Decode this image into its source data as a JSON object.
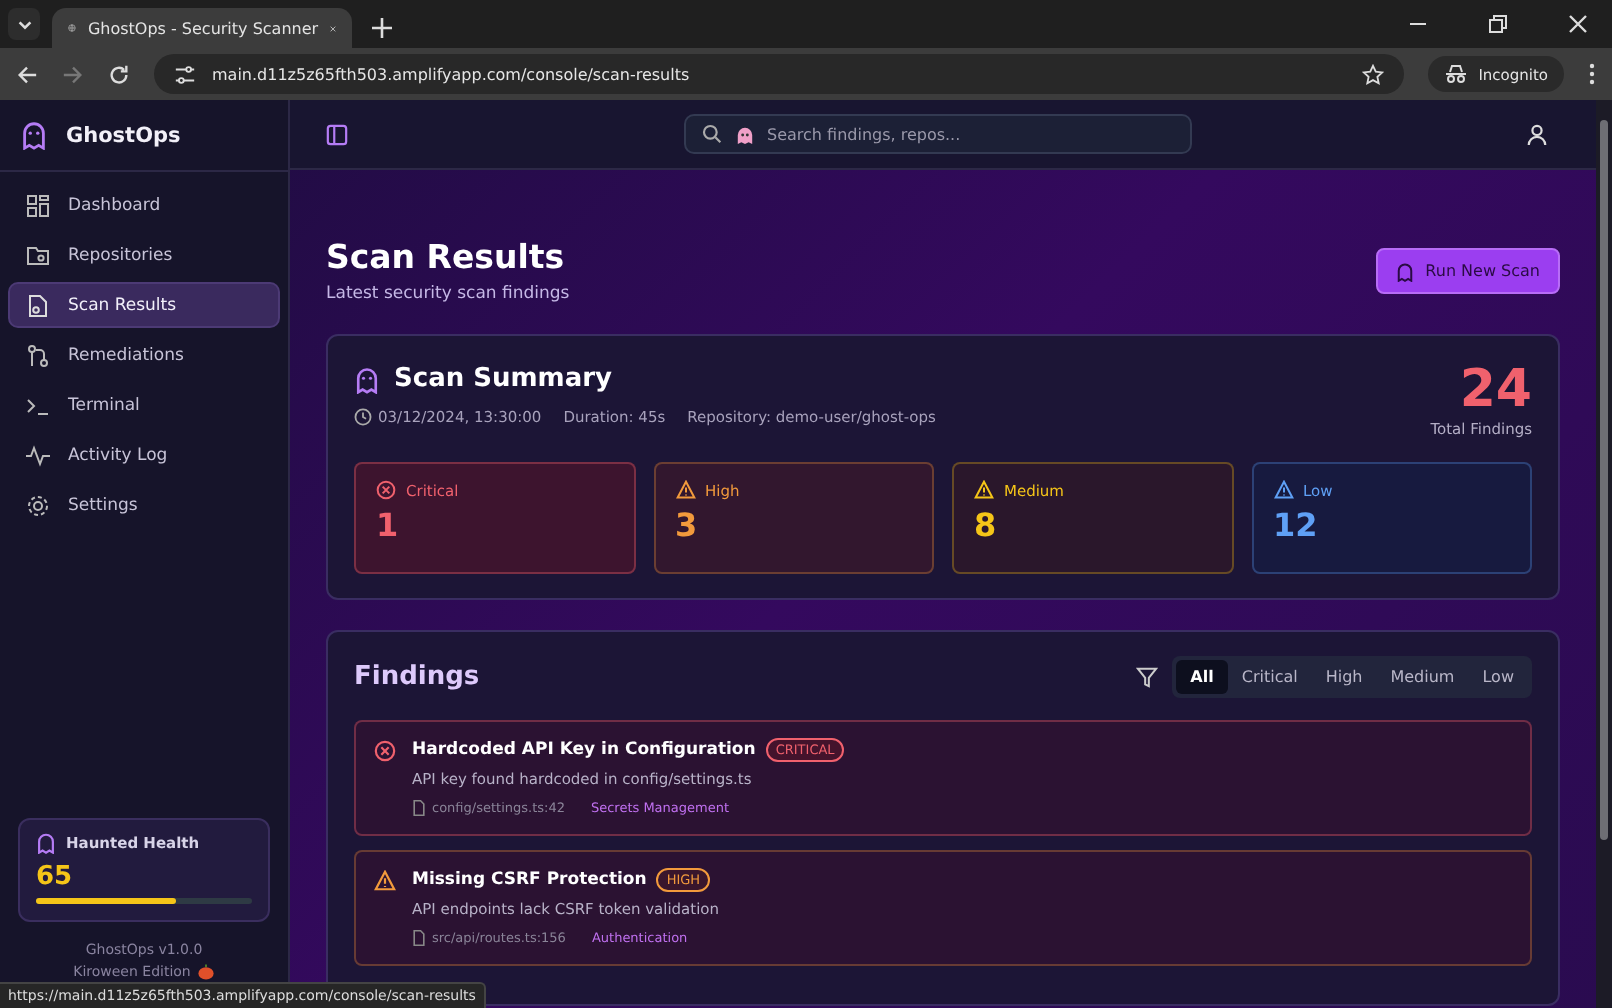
{
  "browser": {
    "tab_title": "GhostOps - Security Scanner",
    "url": "main.d11z5z65fth503.amplifyapp.com/console/scan-results",
    "profile": "Incognito",
    "status_link": "https://main.d11z5z65fth503.amplifyapp.com/console/scan-results"
  },
  "sidebar": {
    "brand": "GhostOps",
    "items": [
      {
        "label": "Dashboard",
        "kind": "grid",
        "selected": false
      },
      {
        "label": "Repositories",
        "kind": "folder",
        "selected": false
      },
      {
        "label": "Scan Results",
        "kind": "file",
        "selected": true
      },
      {
        "label": "Remediations",
        "kind": "branch",
        "selected": false
      },
      {
        "label": "Terminal",
        "kind": "terminal",
        "selected": false
      },
      {
        "label": "Activity Log",
        "kind": "pulse",
        "selected": false
      },
      {
        "label": "Settings",
        "kind": "gear",
        "selected": false
      }
    ],
    "health": {
      "title": "Haunted Health",
      "value": "65",
      "level": 0.65
    },
    "version": "GhostOps v1.0.0",
    "edition": "Kiroween Edition"
  },
  "topbar": {
    "search": {
      "placeholder": "Search findings, repos..."
    }
  },
  "page": {
    "title": "Scan Results",
    "subtitle": "Latest security scan findings",
    "action": "Run New Scan"
  },
  "summary": {
    "title": "Scan Summary",
    "timestamp": "03/12/2024, 13:30:00",
    "duration": "Duration: 45s",
    "repository": "Repository: demo-user/ghost-ops",
    "total": "24",
    "total_label": "Total Findings",
    "severities": [
      {
        "kind": "critical",
        "label": "Critical",
        "count": "1"
      },
      {
        "kind": "high",
        "label": "High",
        "count": "3"
      },
      {
        "kind": "medium",
        "label": "Medium",
        "count": "8"
      },
      {
        "kind": "low",
        "label": "Low",
        "count": "12"
      }
    ]
  },
  "findings": {
    "title": "Findings",
    "filters": [
      {
        "label": "All",
        "selected": true
      },
      {
        "label": "Critical",
        "selected": false
      },
      {
        "label": "High",
        "selected": false
      },
      {
        "label": "Medium",
        "selected": false
      },
      {
        "label": "Low",
        "selected": false
      }
    ],
    "items": [
      {
        "kind": "critical",
        "title": "Hardcoded API Key in Configuration",
        "badge": "CRITICAL",
        "description": "API key found hardcoded in config/settings.ts",
        "location": "config/settings.ts:42",
        "category": "Secrets Management"
      },
      {
        "kind": "high",
        "title": "Missing CSRF Protection",
        "badge": "HIGH",
        "description": "API endpoints lack CSRF token validation",
        "location": "src/api/routes.ts:156",
        "category": "Authentication"
      }
    ]
  }
}
